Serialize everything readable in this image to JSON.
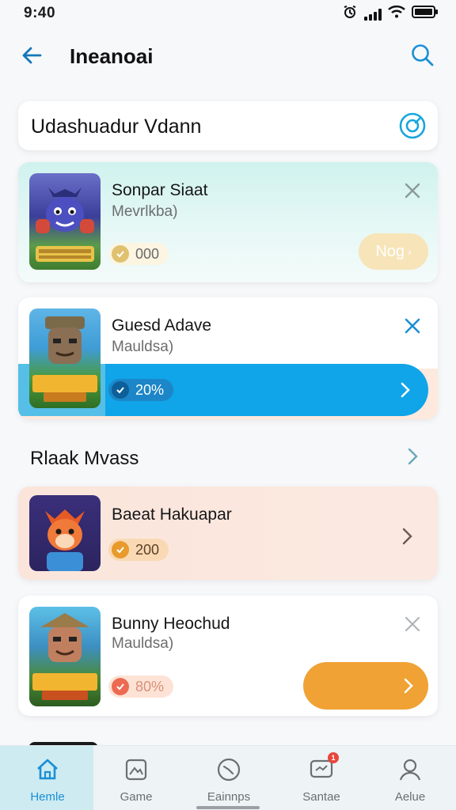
{
  "status_bar": {
    "time": "9:40",
    "icons": [
      "alarm-icon",
      "signal-icon",
      "wifi-icon",
      "battery-icon"
    ]
  },
  "header": {
    "title": "Ineanoai",
    "back_icon": "arrow-left-icon",
    "search_icon": "search-icon"
  },
  "search_bar": {
    "text": "Udashuadur Vdann",
    "icon": "target-icon"
  },
  "games": [
    {
      "name": "Sonpar Siaat",
      "subtitle": "Mevrlkba)",
      "badge": "000",
      "action_label": "Nog",
      "accent": "#e6c97c"
    },
    {
      "name": "Guesd Adave",
      "subtitle": "Mauldsa)",
      "badge": "20%",
      "accent": "#10a4e8"
    }
  ],
  "section": {
    "title": "Rlaak Mvass"
  },
  "more_games": [
    {
      "name": "Baeat Hakuapar",
      "badge": "200",
      "accent": "#e89a2c"
    },
    {
      "name": "Bunny Heochud",
      "subtitle": "Mauldsa)",
      "badge": "80%",
      "accent": "#f0a234"
    }
  ],
  "bottom_nav": [
    {
      "label": "Hemle",
      "icon": "home-icon",
      "active": true
    },
    {
      "label": "Game",
      "icon": "game-icon",
      "active": false
    },
    {
      "label": "Eainnps",
      "icon": "clock-icon",
      "active": false
    },
    {
      "label": "Santae",
      "icon": "chat-icon",
      "active": false,
      "badge": "1"
    },
    {
      "label": "Aelue",
      "icon": "user-icon",
      "active": false
    }
  ],
  "colors": {
    "primary": "#1a8fd6",
    "progress": "#10a4e8",
    "orange": "#f0a234"
  }
}
